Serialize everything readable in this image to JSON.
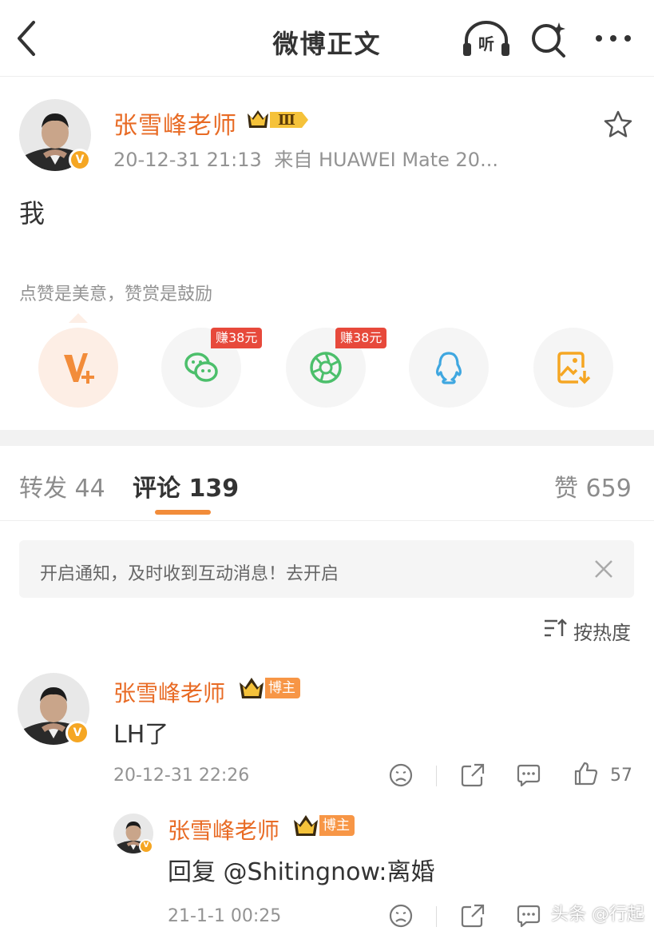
{
  "header": {
    "title": "微博正文",
    "listen_label": "听"
  },
  "post": {
    "author": "张雪峰老师",
    "level_badge": "Ⅲ",
    "timestamp": "20-12-31 21:13",
    "source": "来自 HUAWEI Mate 20...",
    "content": "我",
    "reward_tip": "点赞是美意，赞赏是鼓励"
  },
  "share": {
    "promo_wechat": "赚38元",
    "promo_moments": "赚38元"
  },
  "tabs": {
    "repost": "转发 44",
    "comments": "评论 139",
    "likes": "赞 659"
  },
  "notice": {
    "text": "开启通知，及时收到互动消息！去开启"
  },
  "sort": {
    "label": "按热度"
  },
  "comments": [
    {
      "author": "张雪峰老师",
      "badge": "博主",
      "text": "LH了",
      "time": "20-12-31 22:26",
      "likes": "57"
    },
    {
      "author": "张雪峰老师",
      "badge": "博主",
      "text": "回复 @Shitingnow:离婚",
      "time": "21-1-1 00:25"
    }
  ],
  "watermark": "头条 @行起",
  "colors": {
    "name_orange": "#e86b25",
    "accent_orange": "#f28c3a",
    "vip_gold": "#f5a623",
    "promo_red": "#e7493b",
    "wechat_green": "#4cbf6b",
    "qq_blue": "#3fa7e0"
  }
}
